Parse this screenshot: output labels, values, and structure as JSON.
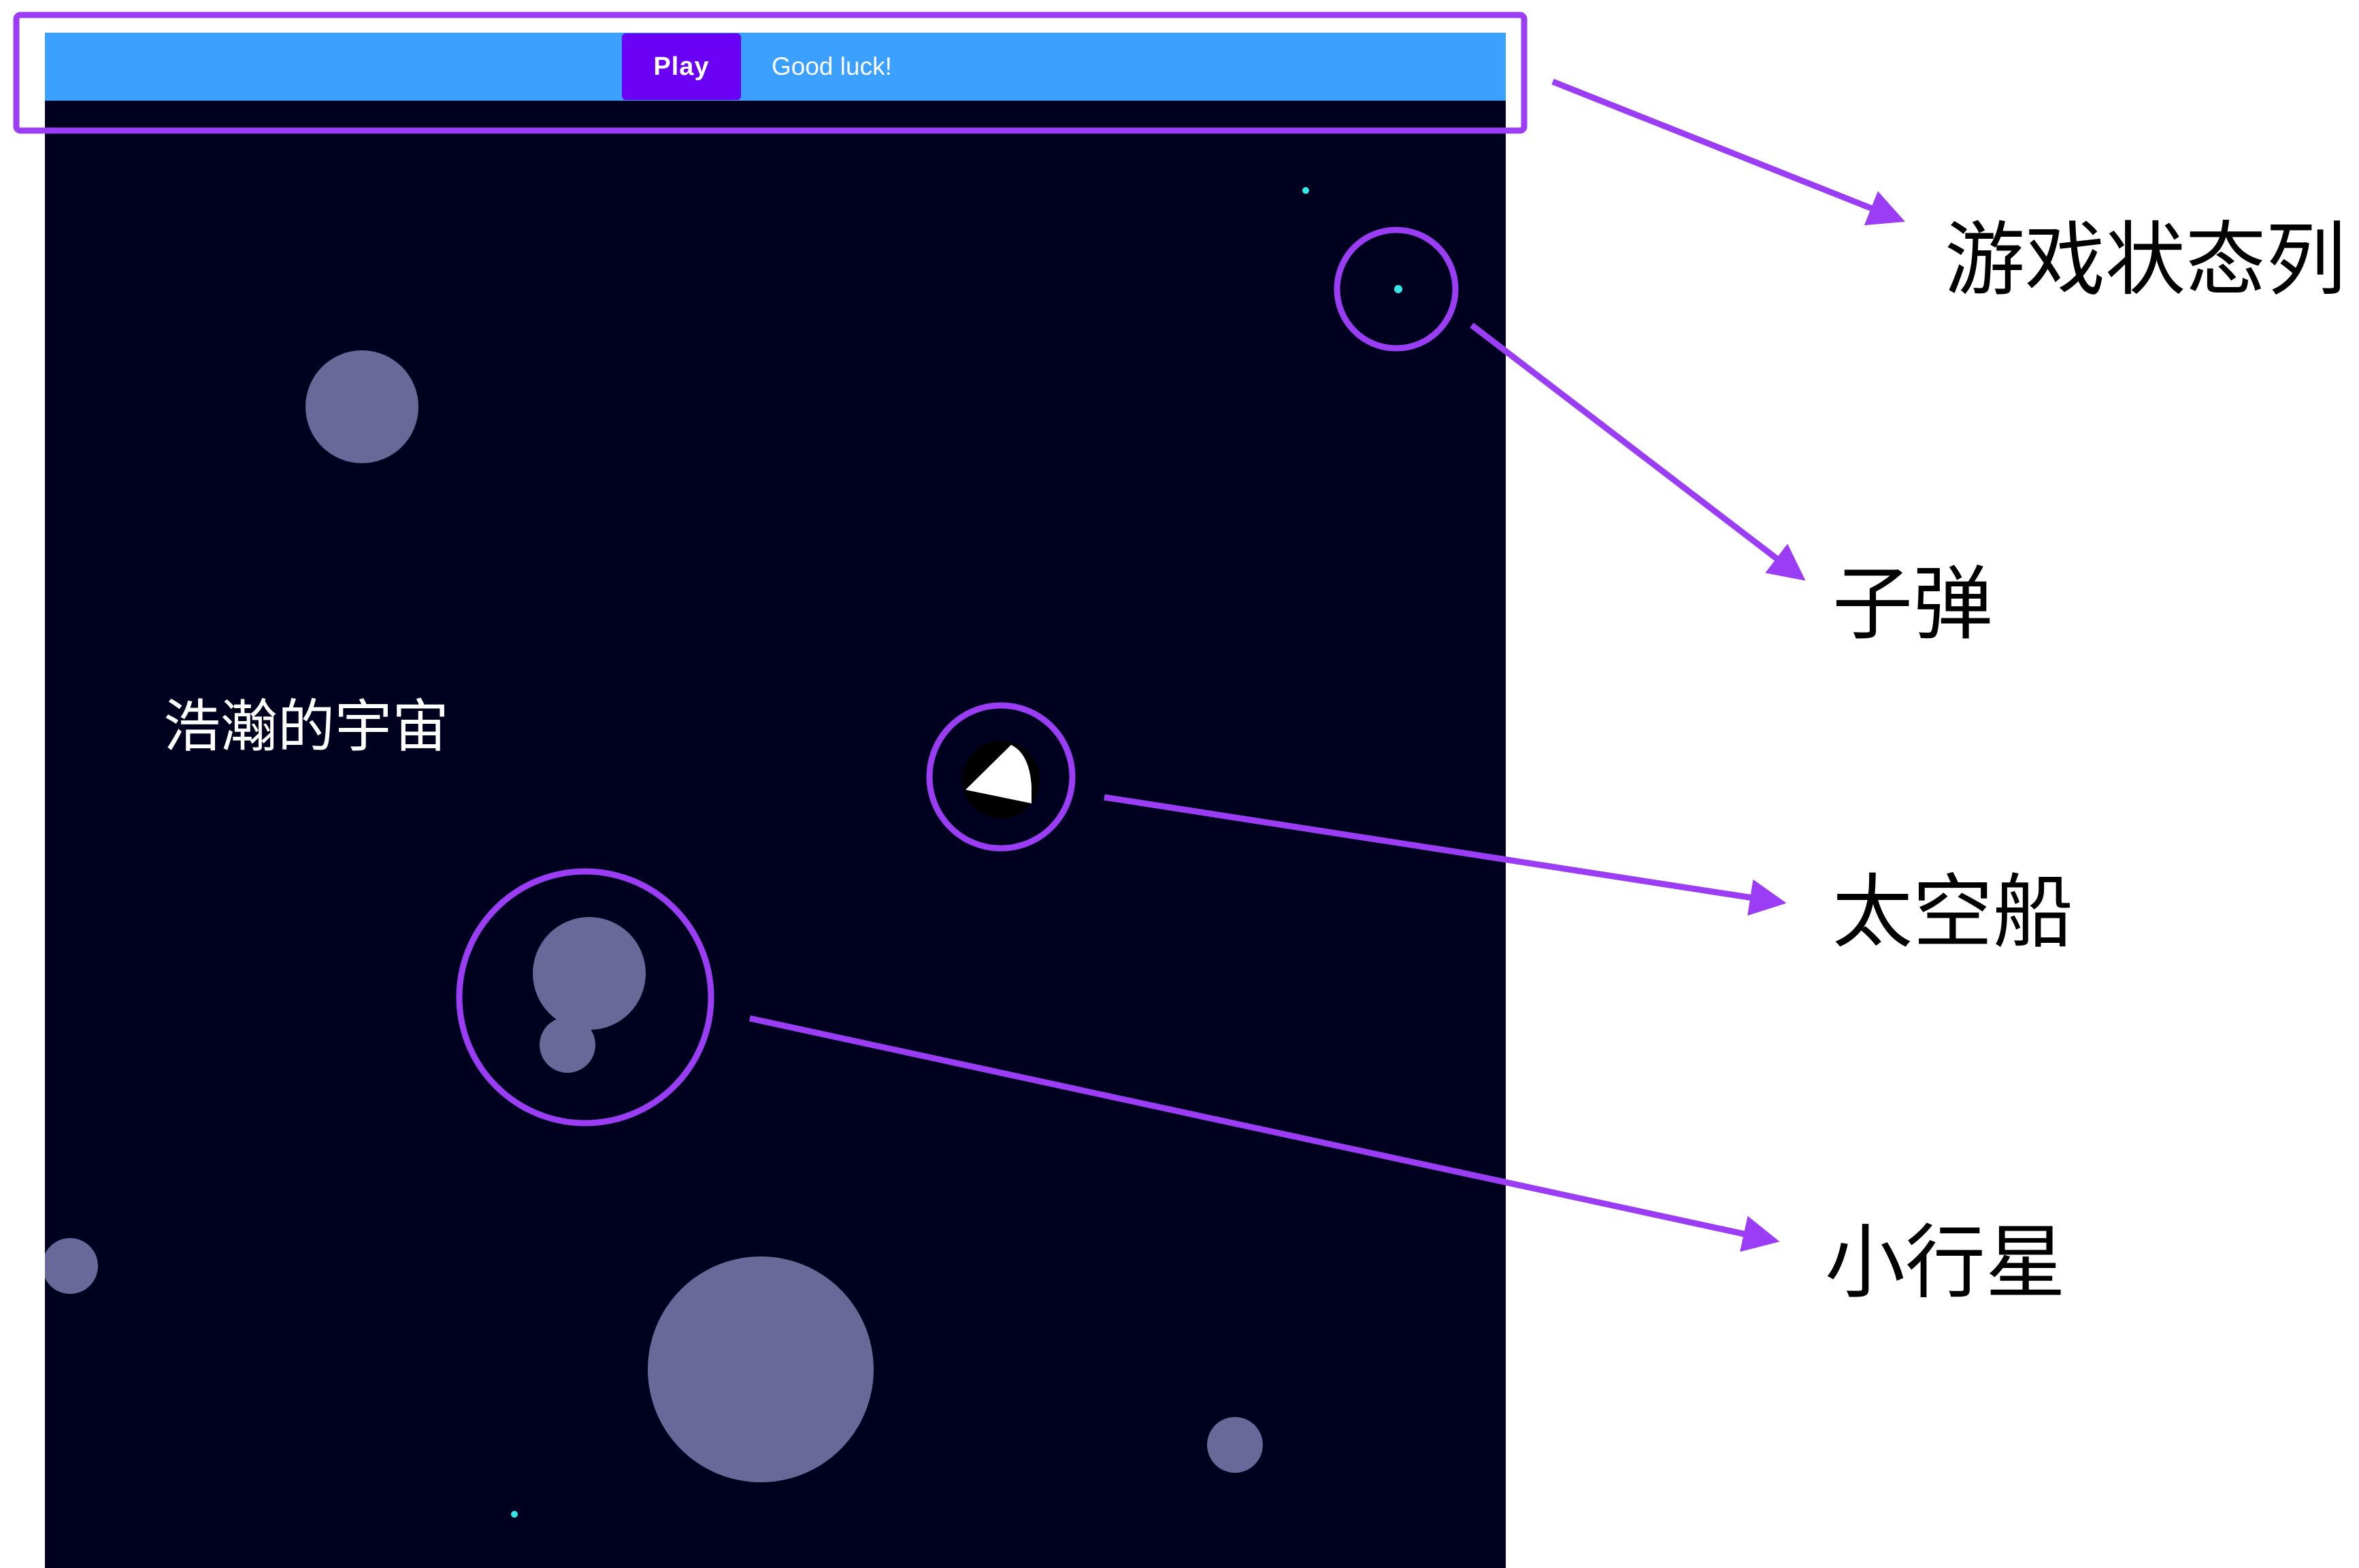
{
  "game": {
    "play_button_label": "Play",
    "status_message": "Good luck!",
    "background_label": "浩瀚的宇宙"
  },
  "annotations": {
    "status_bar": "游戏状态列",
    "bullet": "子弹",
    "spaceship": "太空船",
    "asteroid": "小行星"
  },
  "colors": {
    "status_bar": "#3ba0ff",
    "play_button": "#6a00f4",
    "space": "#00001f",
    "asteroid": "#6a6898",
    "bullet": "#34e8e8",
    "spaceship": "#ffffff",
    "annotation": "#9b3df5"
  }
}
